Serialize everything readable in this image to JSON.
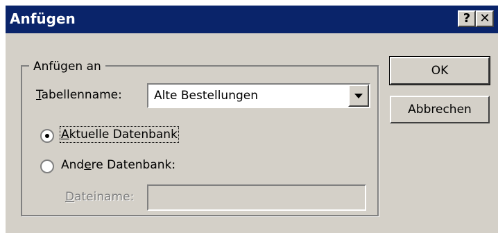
{
  "window": {
    "title": "Anfügen",
    "help_label": "?",
    "close_label": "✕"
  },
  "group": {
    "label": "Anfügen an"
  },
  "table_name": {
    "label_mnemonic": "T",
    "label_rest": "abellenname:",
    "selected_value": "Alte Bestellungen"
  },
  "options": {
    "current_db": {
      "mnemonic": "A",
      "rest": "ktuelle Datenbank",
      "selected": true
    },
    "other_db": {
      "before": "And",
      "mnemonic": "e",
      "after": "re Datenbank:",
      "selected": false
    }
  },
  "filename": {
    "label_mnemonic": "D",
    "label_rest": "ateiname:",
    "value": ""
  },
  "buttons": {
    "ok_label": "OK",
    "cancel_label": "Abbrechen"
  },
  "colors": {
    "titlebar": "#0a246a",
    "dialog_face": "#d4d0c8"
  }
}
